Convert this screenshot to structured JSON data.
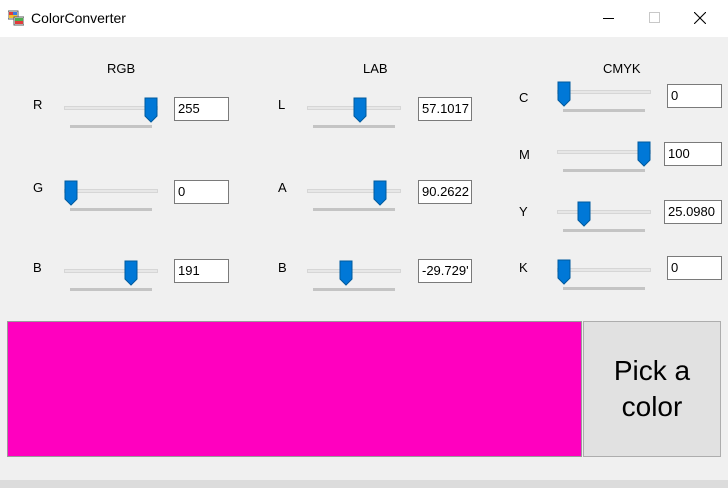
{
  "window": {
    "title": "ColorConverter",
    "controls": {
      "minimize": "minimize-icon",
      "maximize": "maximize-icon",
      "close": "close-icon"
    }
  },
  "rgb": {
    "title": "RGB",
    "channels": [
      {
        "label": "R",
        "value": "255",
        "slider_fraction": 1.0
      },
      {
        "label": "G",
        "value": "0",
        "slider_fraction": 0.0
      },
      {
        "label": "B",
        "value": "191",
        "slider_fraction": 0.75
      }
    ]
  },
  "lab": {
    "title": "LAB",
    "channels": [
      {
        "label": "L",
        "value": "57.1017",
        "slider_fraction": 0.57
      },
      {
        "label": "A",
        "value": "90.2622",
        "slider_fraction": 0.83
      },
      {
        "label": "B",
        "value": "-29.729'",
        "slider_fraction": 0.4
      }
    ]
  },
  "cmyk": {
    "title": "CMYK",
    "channels": [
      {
        "label": "C",
        "value": "0",
        "slider_fraction": 0.0
      },
      {
        "label": "M",
        "value": "100",
        "slider_fraction": 1.0
      },
      {
        "label": "Y",
        "value": "25.0980",
        "slider_fraction": 0.25
      },
      {
        "label": "K",
        "value": "0",
        "slider_fraction": 0.0
      }
    ]
  },
  "preview": {
    "color": "#ff00bf"
  },
  "pick_button": {
    "label": "Pick a color"
  },
  "colors": {
    "accent": "#0078d7",
    "client_bg": "#f0f0f0"
  }
}
